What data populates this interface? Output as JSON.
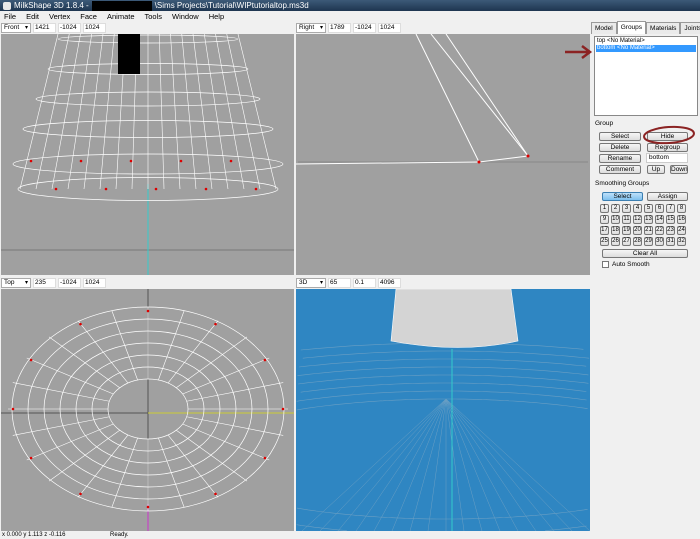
{
  "window": {
    "title_prefix": "MilkShape 3D 1.8.4 -",
    "title_path": "\\Sims Projects\\Tutorial\\WIPtutorialtop.ms3d"
  },
  "menu": [
    "File",
    "Edit",
    "Vertex",
    "Face",
    "Animate",
    "Tools",
    "Window",
    "Help"
  ],
  "viewports": [
    {
      "view": "Front",
      "values": [
        "1421",
        "-1024",
        "1024"
      ]
    },
    {
      "view": "Right",
      "values": [
        "1789",
        "-1024",
        "1024"
      ]
    },
    {
      "view": "Top",
      "values": [
        "235",
        "-1024",
        "1024"
      ]
    },
    {
      "view": "3D",
      "values": [
        "65",
        "0.1",
        "4096"
      ]
    }
  ],
  "panel": {
    "tabs": [
      "Model",
      "Groups",
      "Materials",
      "Joints"
    ],
    "active_tab": "Groups",
    "groups": [
      "top <No Material>",
      "bottom <No Material>"
    ],
    "selected_group": 1,
    "group_section": "Group",
    "buttons": {
      "select": "Select",
      "hide": "Hide",
      "delete": "Delete",
      "regroup": "Regroup",
      "rename": "Rename",
      "comment": "Comment",
      "up": "Up",
      "down": "Down"
    },
    "name_value": "bottom",
    "smoothing_section": "Smoothing Groups",
    "sg_select": "Select",
    "sg_assign": "Assign",
    "sg_numbers": [
      "1",
      "2",
      "3",
      "4",
      "5",
      "6",
      "7",
      "8",
      "9",
      "10",
      "11",
      "12",
      "13",
      "14",
      "15",
      "16",
      "17",
      "18",
      "19",
      "20",
      "21",
      "22",
      "23",
      "24",
      "25",
      "26",
      "27",
      "28",
      "29",
      "30",
      "31",
      "32"
    ],
    "clear_all": "Clear All",
    "auto_smooth": "Auto Smooth"
  },
  "status": {
    "coords": "x 0.000 y 1.113 z -0.116",
    "message": "Ready."
  },
  "colors": {
    "viewport": "#a0a0a0",
    "viewport3d": "#2f86c2",
    "annotation": "#8b2323"
  }
}
